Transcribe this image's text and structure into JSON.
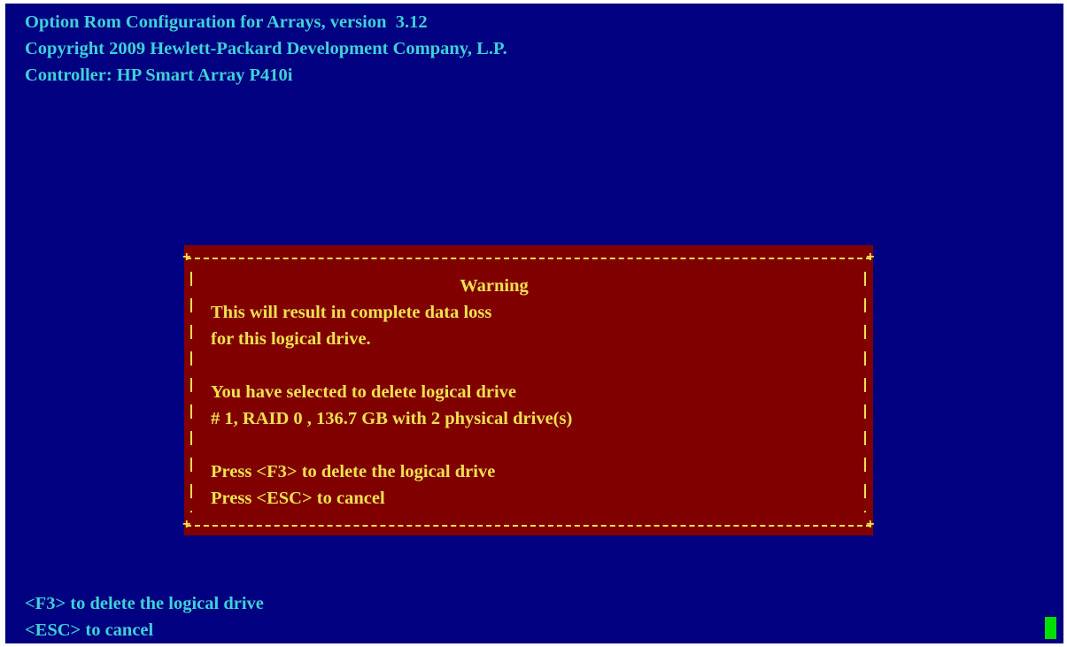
{
  "header": {
    "title_line": "Option Rom Configuration for Arrays, version  3.12",
    "copyright_line": "Copyright 2009 Hewlett-Packard Development Company, L.P.",
    "controller_line": "Controller: HP Smart Array P410i"
  },
  "dialog": {
    "title": "Warning",
    "message_line_1": "This will result in complete data loss",
    "message_line_2": "for this logical drive.",
    "selection_line_1": "You have selected to delete logical drive",
    "selection_line_2": "# 1, RAID 0 , 136.7 GB with 2 physical drive(s)",
    "instruction_line_1": "Press <F3> to delete the logical drive",
    "instruction_line_2": "Press <ESC> to cancel"
  },
  "footer": {
    "hint_line_1": "<F3> to delete the logical drive",
    "hint_line_2": "<ESC> to cancel"
  },
  "colors": {
    "screen_background": "#000080",
    "screen_text": "#3fd0d8",
    "dialog_background": "#800000",
    "dialog_text": "#f0e050",
    "cursor": "#00e000"
  }
}
